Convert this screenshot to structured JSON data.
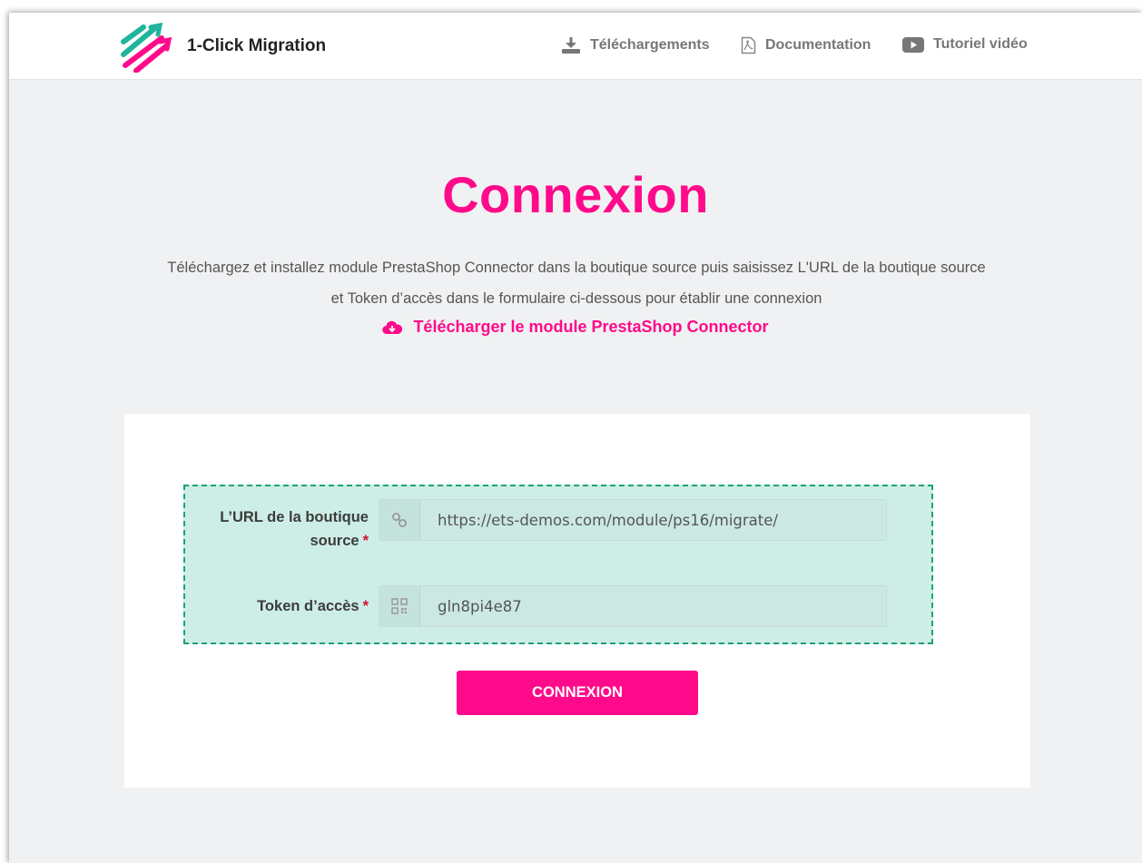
{
  "header": {
    "brand": "1-Click Migration",
    "nav": [
      {
        "label": "Téléchargements",
        "icon": "download-icon"
      },
      {
        "label": "Documentation",
        "icon": "pdf-file-icon"
      },
      {
        "label": "Tutoriel vidéo",
        "icon": "youtube-play-icon"
      }
    ]
  },
  "main": {
    "title": "Connexion",
    "description_line1": "Téléchargez et installez module PrestaShop Connector dans la boutique source puis saisissez L'URL de la boutique source",
    "description_line2": "et Token d’accès dans le formulaire ci-dessous pour établir une connexion",
    "download_link": "Télécharger le module PrestaShop Connector"
  },
  "form": {
    "url_label": "L’URL de la boutique source",
    "url_value": "https://ets-demos.com/module/ps16/migrate/",
    "token_label": "Token d’accès",
    "token_value": "gln8pi4e87",
    "required_mark": "*",
    "submit_label": "CONNEXION"
  },
  "colors": {
    "accent": "#ff0a8a",
    "highlight_bg": "#cdeee6",
    "highlight_border": "#1aa37a"
  }
}
